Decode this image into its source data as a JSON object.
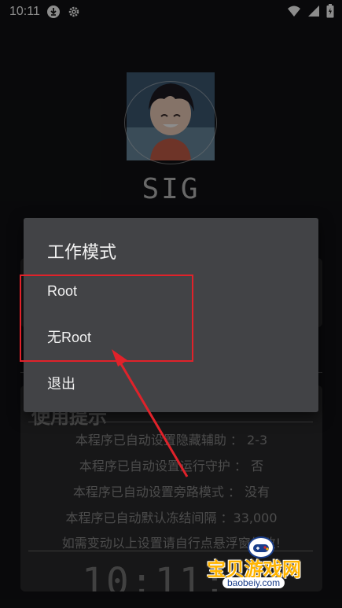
{
  "status_bar": {
    "time": "10:11",
    "icons": [
      "download-icon",
      "gear-icon",
      "wifi-icon",
      "signal-icon",
      "battery-icon"
    ]
  },
  "app": {
    "title": "SIG"
  },
  "background_card": {
    "tips_title": "使用提示",
    "tips": [
      "本程序已自动设置隐藏辅助 ： 2-3",
      "本程序已自动设置运行守护 ： 否",
      "本程序已自动设置旁路模式 ： 没有",
      "本程序已自动默认冻结间隔 ：33,000",
      "如需变动以上设置请自行点悬浮窗修改!"
    ],
    "clock": "10:11:"
  },
  "dialog": {
    "title": "工作模式",
    "items": [
      {
        "label": "Root"
      },
      {
        "label": "无Root"
      },
      {
        "label": "退出"
      }
    ]
  },
  "annotation": {
    "box_color": "#e0222a",
    "arrow_color": "#e0222a"
  },
  "watermark": {
    "text": "宝贝游戏网",
    "url": "baobeiy.com"
  },
  "colors": {
    "background": "#111214",
    "dialog": "#424346",
    "accent": "#e0222a"
  }
}
